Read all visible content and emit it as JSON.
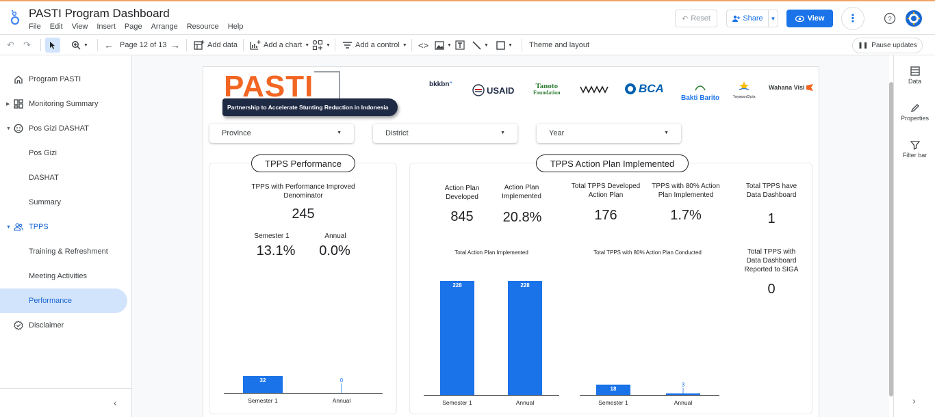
{
  "header": {
    "title": "PASTI Program Dashboard",
    "menu": [
      "File",
      "Edit",
      "View",
      "Insert",
      "Page",
      "Arrange",
      "Resource",
      "Help"
    ],
    "reset_label": "Reset",
    "share_label": "Share",
    "view_label": "View"
  },
  "toolbar": {
    "page_label": "Page 12 of 13",
    "add_data": "Add data",
    "add_chart": "Add a chart",
    "add_control": "Add a control",
    "theme_layout": "Theme and layout",
    "pause_updates": "Pause updates"
  },
  "sidebar": {
    "items": [
      {
        "label": "Program PASTI",
        "icon": "home-icon"
      },
      {
        "label": "Monitoring Summary",
        "icon": "dashboard-icon"
      },
      {
        "label": "Pos Gizi DASHAT",
        "icon": "face-icon"
      },
      {
        "label": "Pos Gizi"
      },
      {
        "label": "DASHAT"
      },
      {
        "label": "Summary"
      },
      {
        "label": "TPPS",
        "icon": "group-icon"
      },
      {
        "label": "Training & Refreshment"
      },
      {
        "label": "Meeting Activities"
      },
      {
        "label": "Performance"
      },
      {
        "label": "Disclaimer",
        "icon": "verified-icon"
      }
    ]
  },
  "rightpanel": {
    "data_label": "Data",
    "properties_label": "Properties",
    "filter_label": "Filter bar"
  },
  "report": {
    "logo_word": "PASTI",
    "logo_tagline": "Partnership to Accelerate Stunting Reduction in Indonesia",
    "partners": [
      "bkkbn",
      "USAID",
      "Tanoto",
      "Foundation",
      "BCA",
      "Bakti Barito",
      "YayasanCipta",
      "Wahana Visi"
    ],
    "filters": {
      "province": "Province",
      "district": "District",
      "year": "Year"
    },
    "tpps_performance": {
      "title": "TPPS Performance",
      "denominator_label": "TPPS with Performance Improved Denominator",
      "denominator_value": "245",
      "semester_label": "Semester 1",
      "semester_value": "13.1%",
      "annual_label": "Annual",
      "annual_value": "0.0%"
    },
    "action_plan": {
      "title": "TPPS Action Plan Implemented",
      "kpis": [
        {
          "label": "Action Plan Developed",
          "value": "845"
        },
        {
          "label": "Action Plan Implemented",
          "value": "20.8%"
        },
        {
          "label": "Total TPPS Developed Action Plan",
          "value": "176"
        },
        {
          "label": "TPPS  with 80% Action Plan Implemented",
          "value": "1.7%"
        },
        {
          "label": "Total TPPS have Data Dashboard",
          "value": "1"
        },
        {
          "label": "Total TPPS with Data Dashboard Reported to SIGA",
          "value": "0"
        }
      ],
      "chart1_title": "Total Action Plan Implemented",
      "chart2_title": "Total TPPS with 80% Action Plan Conducted"
    }
  },
  "colors": {
    "bar": "#1a73e8",
    "orange": "#f26522",
    "navy": "#1f2a44"
  },
  "chart_data": [
    {
      "type": "bar",
      "categories": [
        "Semester 1",
        "Annual"
      ],
      "values": [
        32,
        0
      ],
      "ylim": [
        0,
        100
      ]
    },
    {
      "type": "bar",
      "categories": [
        "Semester 1",
        "Annual"
      ],
      "values": [
        228,
        228
      ],
      "ylim": [
        0,
        228
      ]
    },
    {
      "type": "bar",
      "categories": [
        "Semester 1",
        "Annual"
      ],
      "values": [
        18,
        3
      ],
      "ylim": [
        0,
        100
      ]
    }
  ]
}
